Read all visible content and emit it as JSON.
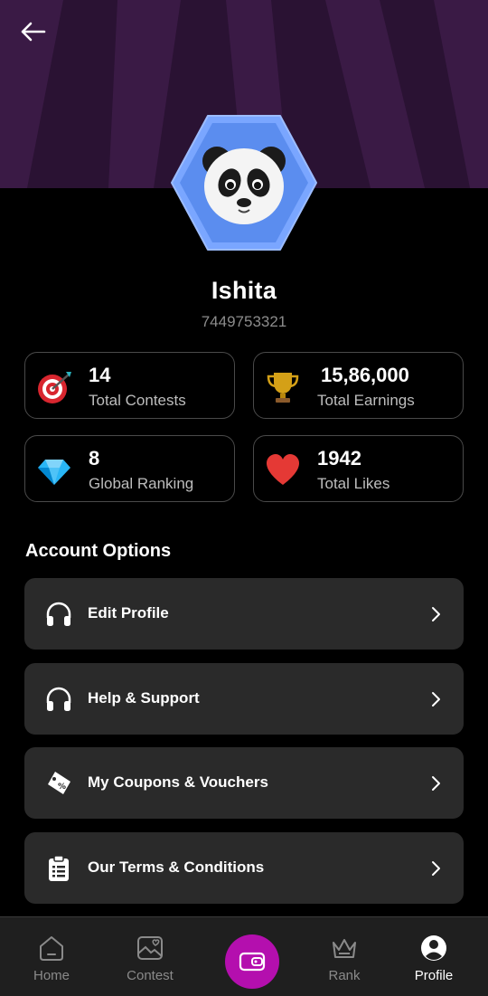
{
  "profile": {
    "name": "Ishita",
    "phone": "7449753321"
  },
  "stats": [
    {
      "value": "14",
      "label": "Total Contests",
      "icon": "target-icon"
    },
    {
      "value": "15,86,000",
      "label": "Total Earnings",
      "icon": "trophy-icon"
    },
    {
      "value": "8",
      "label": "Global Ranking",
      "icon": "diamond-icon"
    },
    {
      "value": "1942",
      "label": "Total Likes",
      "icon": "heart-icon"
    }
  ],
  "account": {
    "title": "Account Options",
    "options": [
      {
        "label": "Edit Profile",
        "icon": "headphones-icon"
      },
      {
        "label": "Help & Support",
        "icon": "headphones-icon"
      },
      {
        "label": "My Coupons & Vouchers",
        "icon": "coupon-icon"
      },
      {
        "label": "Our Terms & Conditions",
        "icon": "clipboard-icon"
      }
    ]
  },
  "nav": {
    "items": [
      {
        "label": "Home",
        "icon": "home-icon"
      },
      {
        "label": "Contest",
        "icon": "contest-icon"
      },
      {
        "label": "",
        "icon": "wallet-icon"
      },
      {
        "label": "Rank",
        "icon": "crown-icon"
      },
      {
        "label": "Profile",
        "icon": "user-icon"
      }
    ],
    "active": "Profile"
  },
  "colors": {
    "header": "#2a1233",
    "avatar": "#5b8def",
    "accent": "#b40fae",
    "card": "#2a2a2a"
  }
}
